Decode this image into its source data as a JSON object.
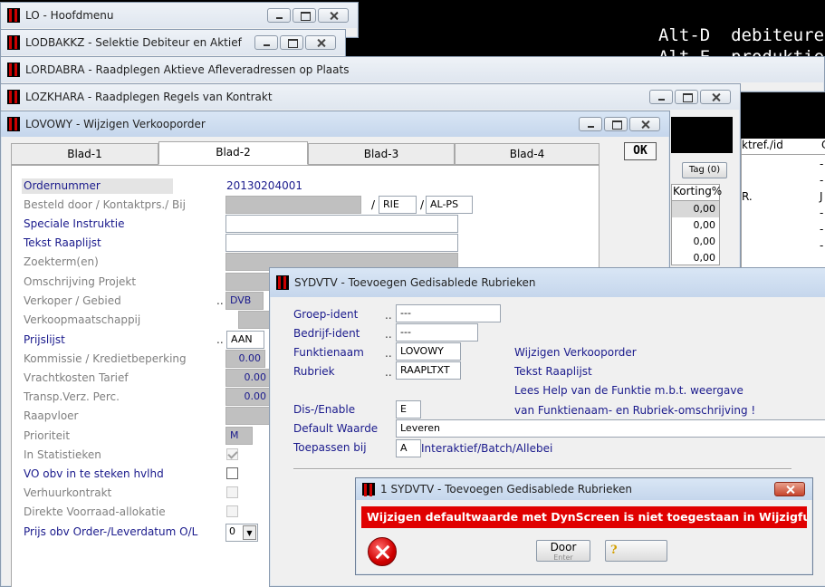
{
  "bg": {
    "alt_d": "Alt-D  debiteuren",
    "alt_e": "Alt-E  produktie"
  },
  "windows": {
    "lo": "LO - Hoofdmenu",
    "lodbakkz": "LODBAKKZ - Selektie Debiteur en Aktief",
    "lordabra": "LORDABRA - Raadplegen Aktieve Afleveradressen op Plaats",
    "lozkhara": "LOZKHARA - Raadplegen Regels van Kontrakt",
    "lovowy": "LOVOWY - Wijzigen Verkooporder",
    "sydvtv": "SYDVTV - Toevoegen Gedisablede Rubrieken",
    "alert": "1 SYDVTV - Toevoegen Gedisablede Rubrieken"
  },
  "lozkhara": {
    "tag_button": "Tag (0)",
    "col_korting": "Korting%",
    "col_ktref": "ktref./id",
    "col_c": "C",
    "korting": [
      "0,00",
      "0,00",
      "0,00",
      "0,00"
    ],
    "dash": "-",
    "r": "R.",
    "j": "J"
  },
  "lovowy": {
    "tabs": [
      "Blad-1",
      "Blad-2",
      "Blad-3",
      "Blad-4"
    ],
    "ok": "OK",
    "labels": {
      "ordernummer": "Ordernummer",
      "besteld": "Besteld door / Kontaktprs./ Bij",
      "speciale": "Speciale Instruktie",
      "tekst": "Tekst Raaplijst",
      "zoekterm": "Zoekterm(en)",
      "omschrijving": "Omschrijving Projekt",
      "verkoper": "Verkoper / Gebied",
      "verkoopmaatschappij": "Verkoopmaatschappij",
      "prijslijst": "Prijslijst",
      "kommissie": "Kommissie / Kredietbeperking",
      "vrachtkosten": "Vrachtkosten Tarief",
      "transp": "Transp.Verz. Perc.",
      "raapvloer": "Raapvloer",
      "prioriteit": "Prioriteit",
      "statistieken": "In Statistieken",
      "vo": "VO obv in te steken hvlhd",
      "verhuur": "Verhuurkontrakt",
      "direkte": "Direkte Voorraad-allokatie",
      "prijs": "Prijs obv Order-/Leverdatum O/L"
    },
    "values": {
      "ordernummer": "20130204001",
      "rie": "RIE",
      "alps": "AL-PS",
      "dvb": "DVB",
      "aan": "AAN",
      "kommissie": "0.00",
      "vracht": "0.00",
      "transp": "0.00",
      "prioriteit": "M",
      "prijs_sel": "0"
    },
    "dots": "..",
    "slash": "/"
  },
  "sydvtv": {
    "labels": {
      "groep": "Groep-ident",
      "bedrijf": "Bedrijf-ident",
      "funktie": "Funktienaam",
      "rubriek": "Rubriek",
      "dis": "Dis-/Enable",
      "default": "Default Waarde",
      "toepassen": "Toepassen bij"
    },
    "values": {
      "groep": "---",
      "bedrijf": "---",
      "funktie": "LOVOWY",
      "rubriek": "RAAPLTXT",
      "dis": "E",
      "default": "Leveren",
      "toepassen": "A"
    },
    "right": {
      "funktie": "Wijzigen Verkooporder",
      "rubriek": "Tekst Raaplijst",
      "help1": "Lees Help van de Funktie m.b.t. weergave",
      "help2": "van Funktienaam- en Rubriek-omschrijving !"
    },
    "toepassen_hint": "Interaktief/Batch/Allebei",
    "dots": ".."
  },
  "alert": {
    "message": "Wijzigen defaultwaarde met DynScreen is niet toegestaan in Wijzigfunkties",
    "door": "Door",
    "enter": "Enter",
    "help_icon": "?"
  }
}
